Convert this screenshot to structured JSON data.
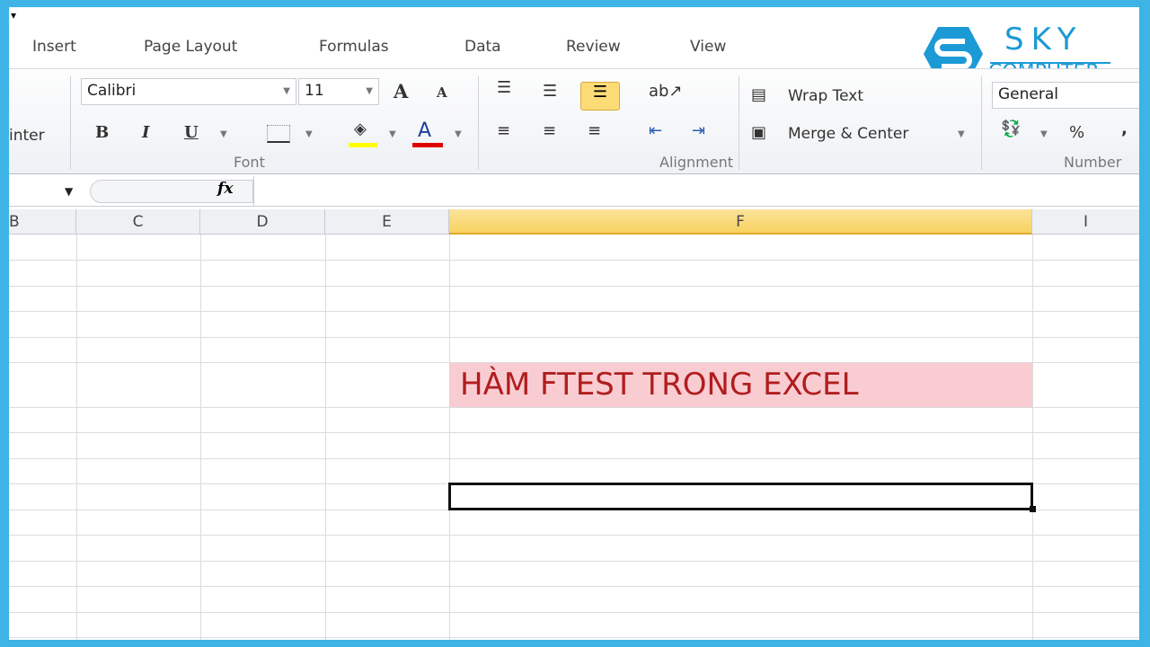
{
  "tabs": [
    "Insert",
    "Page Layout",
    "Formulas",
    "Data",
    "Review",
    "View"
  ],
  "clipboard": {
    "painter_label": "inter"
  },
  "font": {
    "name": "Calibri",
    "size": "11",
    "group_label": "Font",
    "bold": "B",
    "italic": "I",
    "underline": "U",
    "grow": "A",
    "shrink": "A",
    "color_letter": "A",
    "fill_color": "#ffff00",
    "font_color": "#e00000"
  },
  "alignment": {
    "wrap_text": "Wrap Text",
    "merge_center": "Merge & Center",
    "group_label": "Alignment"
  },
  "number": {
    "format": "General",
    "percent": "%",
    "comma": ",",
    "group_label": "Number"
  },
  "formula_bar": {
    "fx": "fx",
    "value": ""
  },
  "columns": [
    "B",
    "C",
    "D",
    "E",
    "F",
    "I"
  ],
  "selected_column": "F",
  "cell_title": {
    "text": "HÀM FTEST TRONG EXCEL",
    "color": "#b01e1e",
    "background": "#f9ccd2"
  },
  "logo": {
    "line1": "SKY",
    "line2": "COMPUTER",
    "color": "#1c9ad6"
  }
}
